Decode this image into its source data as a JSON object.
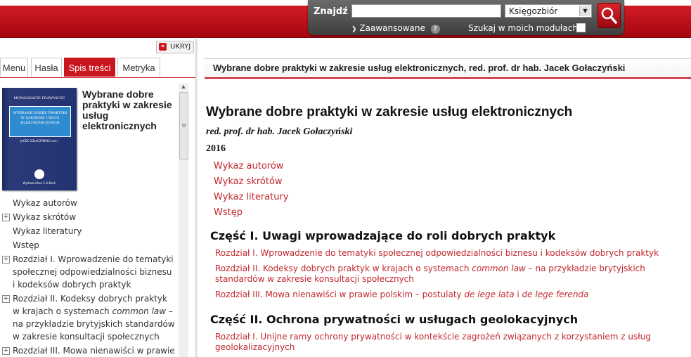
{
  "topbar": {
    "search_label": "Znajdź",
    "search_value": "",
    "scope_selected": "Księgozbiór",
    "advanced_label": "Zaawansowane",
    "help": "?",
    "modules_label": "Szukaj w moich modułach"
  },
  "sidebar": {
    "hide_label": "UKRYJ",
    "tabs": [
      "Menu",
      "Hasła",
      "Spis treści",
      "Metryka"
    ],
    "active_tab": "Spis treści",
    "book_title": "Wybrane dobre praktyki w zakresie usług elektronicznych",
    "cover": {
      "series": "MONOGRAFIE PRAWNICZE",
      "title": "WYBRANE DOBRE PRAKTYKI W ZAKRESIE USŁUG ELEKTRONICZNYCH",
      "author": "JACEK GOŁACZYŃSKI (red.)",
      "publisher": "Wydawnictwo C.H.Beck"
    },
    "toc": [
      {
        "text": "Wykaz autorów",
        "expandable": false
      },
      {
        "text": "Wykaz skrótów",
        "expandable": true
      },
      {
        "text": "Wykaz literatury",
        "expandable": false
      },
      {
        "text": "Wstęp",
        "expandable": false
      },
      {
        "text": "Rozdział I. Wprowadzenie do tematyki społecznej odpowiedzialności biznesu i kodeksów dobrych praktyk",
        "expandable": true
      },
      {
        "text": "Rozdział II. Kodeksy dobrych praktyk w krajach o systemach common law – na przykładzie brytyjskich standardów w zakresie konsultacji społecznych",
        "expandable": true
      },
      {
        "text": "Rozdział III. Mowa nienawiści w prawie",
        "expandable": true
      }
    ]
  },
  "main": {
    "header_title": "Wybrane dobre praktyki w zakresie usług elektronicznych, red. prof. dr hab. Jacek Gołaczyński",
    "doc_title": "Wybrane dobre praktyki w zakresie usług elektronicznych",
    "editor": "red. prof. dr hab. Jacek Gołaczyński",
    "year": "2016",
    "front_links": [
      "Wykaz autorów",
      "Wykaz skrótów",
      "Wykaz literatury",
      "Wstęp"
    ],
    "parts": [
      {
        "title": "Część I. Uwagi wprowadzające do roli dobrych praktyk",
        "chapters": [
          {
            "pre": "Rozdział I. Wprowadzenie do tematyki społecznej odpowiedzialności biznesu i kodeksów dobrych praktyk"
          },
          {
            "pre": "Rozdział II. Kodeksy dobrych praktyk w krajach o systemach ",
            "it1": "common law",
            "mid": " – na przykładzie brytyjskich standardów w zakresie konsultacji społecznych"
          },
          {
            "pre": "Rozdział III. Mowa nienawiści w prawie polskim – postulaty ",
            "it1": "de lege lata",
            "mid": " i ",
            "it2": "de lege ferenda"
          }
        ]
      },
      {
        "title": "Część II. Ochrona prywatności w usługach geolokacyjnych",
        "chapters": [
          {
            "pre": "Rozdział I. Unijne ramy ochrony prywatności w kontekście zagrożeń związanych z korzystaniem z usług geolokalizacyjnych"
          }
        ]
      }
    ]
  },
  "colors": {
    "accent": "#c9151e",
    "link": "#c1272d"
  }
}
